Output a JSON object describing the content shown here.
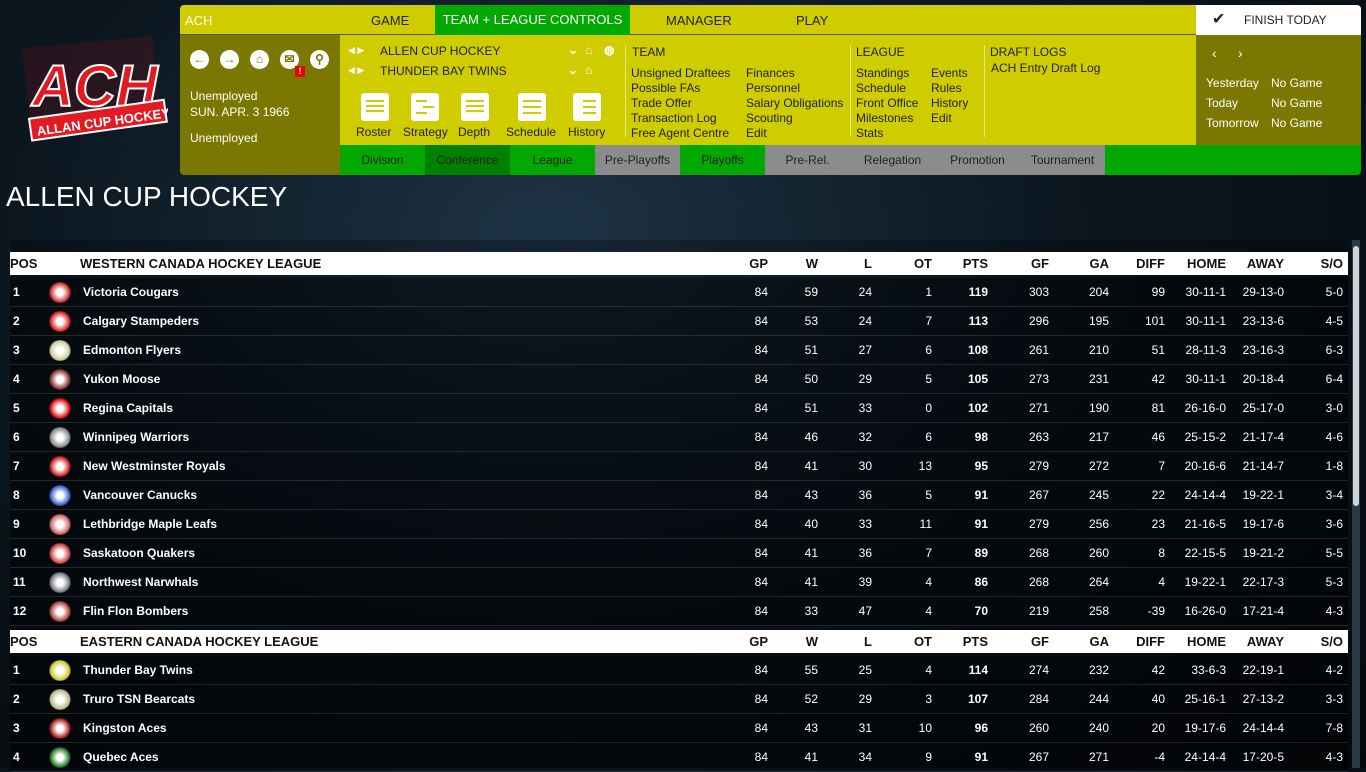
{
  "logo": {
    "text": "ACH",
    "subtext": "ALLAN CUP HOCKEY"
  },
  "topnav": {
    "league_abbr": "ACH",
    "game": "GAME",
    "team_league": "TEAM + LEAGUE CONTROLS",
    "manager": "MANAGER",
    "play": "PLAY",
    "finish": "FINISH TODAY"
  },
  "left": {
    "status1": "Unemployed",
    "date": "SUN. APR. 3 1966",
    "status2": "Unemployed",
    "badge": "!"
  },
  "selectors": {
    "league": "ALLEN CUP HOCKEY",
    "team": "THUNDER BAY TWINS"
  },
  "quick": [
    "Roster",
    "Strategy",
    "Depth",
    "Schedule",
    "History"
  ],
  "team_menu": {
    "title": "TEAM",
    "col1": [
      "Unsigned Draftees",
      "Possible FAs",
      "Trade Offer",
      "Transaction Log",
      "Free Agent Centre"
    ],
    "col2": [
      "Finances",
      "Personnel",
      "Salary Obligations",
      "Scouting",
      "Edit"
    ]
  },
  "league_menu": {
    "title": "LEAGUE",
    "col1": [
      "Standings",
      "Schedule",
      "Front Office",
      "Milestones",
      "Stats"
    ],
    "col2": [
      "Events",
      "Rules",
      "History",
      "Edit"
    ]
  },
  "draft_menu": {
    "title": "DRAFT LOGS",
    "items": [
      "ACH Entry Draft Log"
    ]
  },
  "games": [
    {
      "day": "Yesterday",
      "val": "No Game"
    },
    {
      "day": "Today",
      "val": "No Game"
    },
    {
      "day": "Tomorrow",
      "val": "No Game"
    }
  ],
  "tabs": [
    "Division",
    "Conference",
    "League",
    "Pre-Playoffs",
    "Playoffs",
    "Pre-Rel.",
    "Relegation",
    "Promotion",
    "Tournament"
  ],
  "active_tab": "Conference",
  "colors": {
    "yellow": "#cfcd00",
    "olive": "#7a7800",
    "green": "#00a800",
    "active_green": "#008000",
    "gray": "#8c8c8c"
  },
  "page_title": "ALLEN CUP HOCKEY",
  "columns": [
    "POS",
    "GP",
    "W",
    "L",
    "OT",
    "PTS",
    "GF",
    "GA",
    "DIFF",
    "HOME",
    "AWAY",
    "S/O"
  ],
  "conferences": [
    {
      "name": "WESTERN CANADA HOCKEY LEAGUE",
      "rows": [
        [
          "1",
          "Victoria Cougars",
          "84",
          "59",
          "24",
          "1",
          "119",
          "303",
          "204",
          "99",
          "30-11-1",
          "29-13-0",
          "5-0"
        ],
        [
          "2",
          "Calgary Stampeders",
          "84",
          "53",
          "24",
          "7",
          "113",
          "296",
          "195",
          "101",
          "30-11-1",
          "23-13-6",
          "4-5"
        ],
        [
          "3",
          "Edmonton Flyers",
          "84",
          "51",
          "27",
          "6",
          "108",
          "261",
          "210",
          "51",
          "28-11-3",
          "23-16-3",
          "6-3"
        ],
        [
          "4",
          "Yukon Moose",
          "84",
          "50",
          "29",
          "5",
          "105",
          "273",
          "231",
          "42",
          "30-11-1",
          "20-18-4",
          "6-4"
        ],
        [
          "5",
          "Regina Capitals",
          "84",
          "51",
          "33",
          "0",
          "102",
          "271",
          "190",
          "81",
          "26-16-0",
          "25-17-0",
          "3-0"
        ],
        [
          "6",
          "Winnipeg Warriors",
          "84",
          "46",
          "32",
          "6",
          "98",
          "263",
          "217",
          "46",
          "25-15-2",
          "21-17-4",
          "4-6"
        ],
        [
          "7",
          "New Westminster Royals",
          "84",
          "41",
          "30",
          "13",
          "95",
          "279",
          "272",
          "7",
          "20-16-6",
          "21-14-7",
          "1-8"
        ],
        [
          "8",
          "Vancouver Canucks",
          "84",
          "43",
          "36",
          "5",
          "91",
          "267",
          "245",
          "22",
          "24-14-4",
          "19-22-1",
          "3-4"
        ],
        [
          "9",
          "Lethbridge Maple Leafs",
          "84",
          "40",
          "33",
          "11",
          "91",
          "279",
          "256",
          "23",
          "21-16-5",
          "19-17-6",
          "3-6"
        ],
        [
          "10",
          "Saskatoon Quakers",
          "84",
          "41",
          "36",
          "7",
          "89",
          "268",
          "260",
          "8",
          "22-15-5",
          "19-21-2",
          "5-5"
        ],
        [
          "11",
          "Northwest Narwhals",
          "84",
          "41",
          "39",
          "4",
          "86",
          "268",
          "264",
          "4",
          "19-22-1",
          "22-17-3",
          "5-3"
        ],
        [
          "12",
          "Flin Flon Bombers",
          "84",
          "33",
          "47",
          "4",
          "70",
          "219",
          "258",
          "-39",
          "16-26-0",
          "17-21-4",
          "4-3"
        ]
      ]
    },
    {
      "name": "EASTERN CANADA HOCKEY LEAGUE",
      "rows": [
        [
          "1",
          "Thunder Bay Twins",
          "84",
          "55",
          "25",
          "4",
          "114",
          "274",
          "232",
          "42",
          "33-6-3",
          "22-19-1",
          "4-2"
        ],
        [
          "2",
          "Truro TSN Bearcats",
          "84",
          "52",
          "29",
          "3",
          "107",
          "284",
          "244",
          "40",
          "25-16-1",
          "27-13-2",
          "3-3"
        ],
        [
          "3",
          "Kingston Aces",
          "84",
          "43",
          "31",
          "10",
          "96",
          "260",
          "240",
          "20",
          "19-17-6",
          "24-14-4",
          "7-8"
        ],
        [
          "4",
          "Quebec Aces",
          "84",
          "41",
          "34",
          "9",
          "91",
          "267",
          "271",
          "-4",
          "24-14-4",
          "17-20-5",
          "4-3"
        ]
      ]
    }
  ]
}
